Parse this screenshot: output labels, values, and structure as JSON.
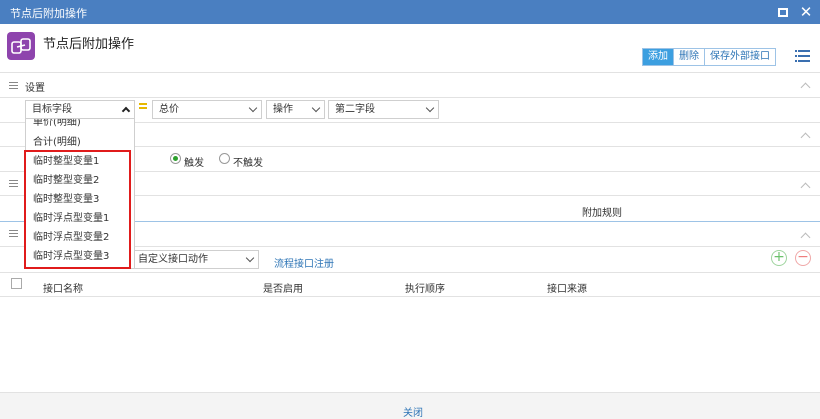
{
  "window": {
    "title": "节点后附加操作"
  },
  "header": {
    "title": "节点后附加操作"
  },
  "toolbar": {
    "add_label": "添加",
    "delete_label": "删除",
    "save_label": "保存外部接口"
  },
  "settings": {
    "label": "设置",
    "target_field": "目标字段",
    "total_field": "总价",
    "operation": "操作",
    "second_field": "第二字段"
  },
  "dropdown": {
    "options": [
      "单价(明细)",
      "合计(明细)",
      "临时整型变量1",
      "临时整型变量2",
      "临时整型变量3",
      "临时浮点型变量1",
      "临时浮点型变量2",
      "临时浮点型变量3"
    ]
  },
  "trigger": {
    "on_label": "触发",
    "off_label": "不触发",
    "selected": "触发"
  },
  "rules": {
    "column": "附加规则"
  },
  "interface": {
    "action_select": "自定义接口动作",
    "register_link": "流程接口注册",
    "columns": [
      "接口名称",
      "是否启用",
      "执行顺序",
      "接口来源"
    ]
  },
  "footer": {
    "close_label": "关闭"
  },
  "colors": {
    "titlebar": "#4a7fc1",
    "primary": "#3c9fe0",
    "highlight": "#e01b1b",
    "link": "#2e75b6"
  }
}
